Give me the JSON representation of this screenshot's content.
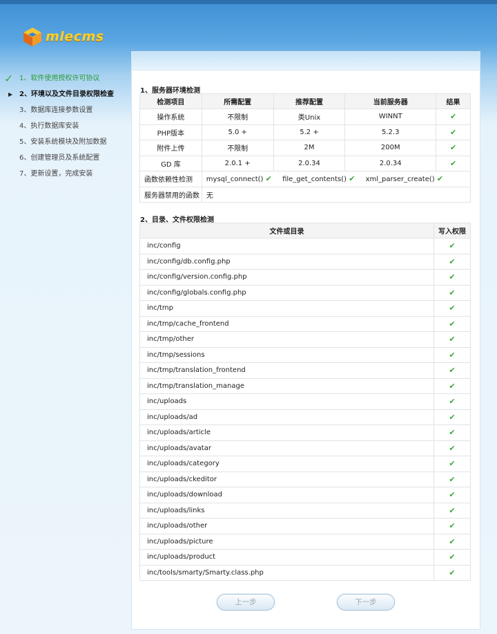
{
  "logo": {
    "text": "mlecms"
  },
  "steps": [
    {
      "num": "1、",
      "label": "软件使用授权许可协议",
      "state": "done"
    },
    {
      "num": "2、",
      "label": "环境以及文件目录权限检查",
      "state": "current"
    },
    {
      "num": "3、",
      "label": "数据库连接参数设置",
      "state": "pending"
    },
    {
      "num": "4、",
      "label": "执行数据库安装",
      "state": "pending"
    },
    {
      "num": "5、",
      "label": "安装系统模块及附加数据",
      "state": "pending"
    },
    {
      "num": "6、",
      "label": "创建管理员及系统配置",
      "state": "pending"
    },
    {
      "num": "7、",
      "label": "更新设置，完成安装",
      "state": "pending"
    }
  ],
  "env_section": {
    "title": "1、服务器环境检测",
    "headers": [
      "检测项目",
      "所需配置",
      "推荐配置",
      "当前服务器",
      "结果"
    ],
    "rows": [
      {
        "item": "操作系统",
        "required": "不限制",
        "recommended": "类Unix",
        "current": "WINNT"
      },
      {
        "item": "PHP版本",
        "required": "5.0 +",
        "recommended": "5.2 +",
        "current": "5.2.3"
      },
      {
        "item": "附件上传",
        "required": "不限制",
        "recommended": "2M",
        "current": "200M"
      },
      {
        "item": "GD 库",
        "required": "2.0.1 +",
        "recommended": "2.0.34",
        "current": "2.0.34"
      }
    ],
    "func_label": "函数依赖性检测",
    "funcs": [
      "mysql_connect()",
      "file_get_contents()",
      "xml_parser_create()"
    ],
    "disabled_label": "服务器禁用的函数",
    "disabled_value": "无"
  },
  "perm_section": {
    "title": "2、目录、文件权限检测",
    "headers": [
      "文件或目录",
      "写入权限"
    ],
    "paths": [
      "inc/config",
      "inc/config/db.config.php",
      "inc/config/version.config.php",
      "inc/config/globals.config.php",
      "inc/tmp",
      "inc/tmp/cache_frontend",
      "inc/tmp/other",
      "inc/tmp/sessions",
      "inc/tmp/translation_frontend",
      "inc/tmp/translation_manage",
      "inc/uploads",
      "inc/uploads/ad",
      "inc/uploads/article",
      "inc/uploads/avatar",
      "inc/uploads/category",
      "inc/uploads/ckeditor",
      "inc/uploads/download",
      "inc/uploads/links",
      "inc/uploads/other",
      "inc/uploads/picture",
      "inc/uploads/product",
      "inc/tools/smarty/Smarty.class.php"
    ]
  },
  "buttons": {
    "prev": "上一步",
    "next": "下一步"
  },
  "icons": {
    "ok": "check-icon",
    "done": "checkmark-icon",
    "current": "triangle-right-icon"
  },
  "colors": {
    "ok": "#3aa53a",
    "done_text": "#2a9a3a",
    "header_blue": "#3f8fd4"
  }
}
